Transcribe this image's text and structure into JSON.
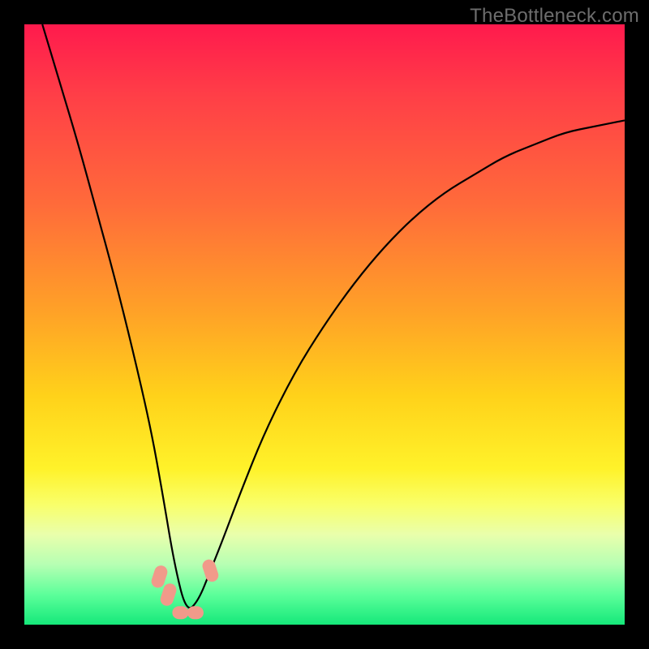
{
  "watermark": "TheBottleneck.com",
  "chart_data": {
    "type": "line",
    "title": "",
    "xlabel": "",
    "ylabel": "",
    "xlim": [
      0,
      100
    ],
    "ylim": [
      0,
      100
    ],
    "grid": false,
    "legend": false,
    "note": "Axis values estimated in chart-area percent (0–100 on each axis). Curve is a V-shape dipping to near 0 at x≈27 and not touching y=0 elsewhere.",
    "series": [
      {
        "name": "curve",
        "color": "#000000",
        "x": [
          3,
          6,
          9,
          12,
          15,
          18,
          21,
          23,
          25,
          27,
          29,
          31,
          33,
          36,
          40,
          45,
          50,
          55,
          60,
          65,
          70,
          75,
          80,
          85,
          90,
          95,
          100
        ],
        "y": [
          100,
          90,
          80,
          69,
          58,
          46,
          33,
          22,
          10,
          2,
          4,
          9,
          14,
          22,
          32,
          42,
          50,
          57,
          63,
          68,
          72,
          75,
          78,
          80,
          82,
          83,
          84
        ]
      }
    ],
    "markers": [
      {
        "name": "blob-left-1",
        "x": 22.5,
        "y": 8,
        "color": "#f19a8a"
      },
      {
        "name": "blob-left-2",
        "x": 24.0,
        "y": 5,
        "color": "#f19a8a"
      },
      {
        "name": "blob-bottom-1",
        "x": 26.0,
        "y": 2,
        "color": "#f19a8a"
      },
      {
        "name": "blob-bottom-2",
        "x": 28.5,
        "y": 2,
        "color": "#f19a8a"
      },
      {
        "name": "blob-right-1",
        "x": 31.0,
        "y": 9,
        "color": "#f19a8a"
      }
    ],
    "background_gradient": {
      "type": "vertical",
      "stops": [
        {
          "pos": 0,
          "color": "#ff1a4d"
        },
        {
          "pos": 30,
          "color": "#ff6b3a"
        },
        {
          "pos": 62,
          "color": "#ffd21a"
        },
        {
          "pos": 80,
          "color": "#f9ff6a"
        },
        {
          "pos": 100,
          "color": "#15e87a"
        }
      ]
    }
  }
}
